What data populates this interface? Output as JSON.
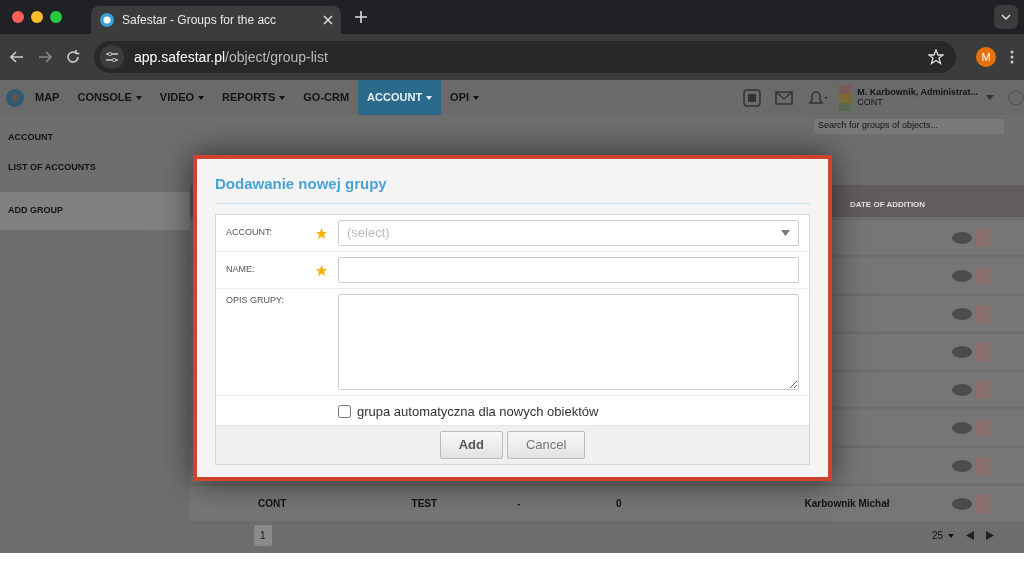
{
  "browser": {
    "tab_title": "Safestar - Groups for the acc",
    "url_host": "app.safestar.pl",
    "url_path": "/object/group-list",
    "profile_initial": "M"
  },
  "nav": {
    "items": [
      {
        "label": "MAP",
        "dropdown": false,
        "selected": false
      },
      {
        "label": "CONSOLE",
        "dropdown": true,
        "selected": false
      },
      {
        "label": "VIDEO",
        "dropdown": true,
        "selected": false
      },
      {
        "label": "REPORTS",
        "dropdown": true,
        "selected": false
      },
      {
        "label": "GO-CRM",
        "dropdown": false,
        "selected": false
      },
      {
        "label": "ACCOUNT",
        "dropdown": true,
        "selected": true
      },
      {
        "label": "OPI",
        "dropdown": true,
        "selected": false
      }
    ],
    "user": {
      "name": "M. Karbownik, Administrat...",
      "role": "CONT"
    }
  },
  "sidebar": {
    "items": [
      {
        "label": "ACCOUNT",
        "selected": false
      },
      {
        "label": "LIST OF ACCOUNTS",
        "selected": false
      },
      {
        "label": "ADD GROUP",
        "selected": true
      }
    ]
  },
  "search": {
    "placeholder": "Search for groups of objects..."
  },
  "table": {
    "columns": [
      "DATE OF ADDITION"
    ],
    "last_row": [
      "CONT",
      "TEST",
      "-",
      "0",
      "Karbownik Michał"
    ]
  },
  "pagination": {
    "page": "1",
    "page_size": "25"
  },
  "dialog": {
    "title": "Dodawanie nowej grupy",
    "fields": [
      {
        "kind": "select",
        "label": "ACCOUNT:",
        "required": true,
        "placeholder": "(select)"
      },
      {
        "kind": "text",
        "label": "NAME:",
        "required": true
      },
      {
        "kind": "textarea",
        "label": "OPIS GRUPY:",
        "required": false
      }
    ],
    "checkbox": {
      "label": "grupa automatyczna dla nowych obiektów",
      "checked": false
    },
    "buttons": [
      {
        "label": "Add",
        "kind": "primary"
      },
      {
        "label": "Cancel",
        "kind": "default"
      }
    ]
  }
}
